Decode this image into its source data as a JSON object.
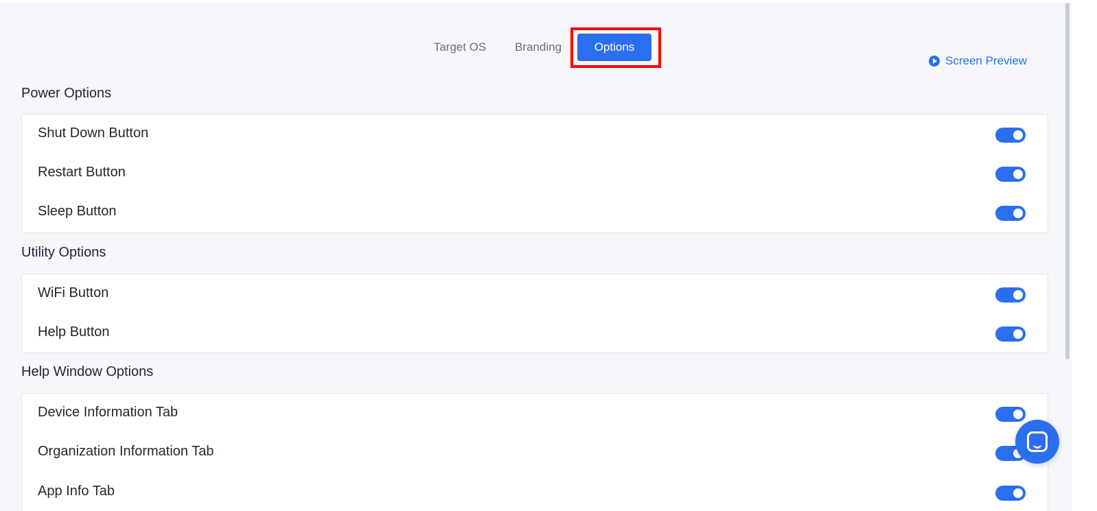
{
  "tabs": {
    "target_os": "Target OS",
    "branding": "Branding",
    "options": "Options"
  },
  "preview": {
    "label": "Screen Preview",
    "icon": "play-circle-icon"
  },
  "sections": [
    {
      "title": "Power Options",
      "items": [
        {
          "label": "Shut Down Button",
          "enabled": true
        },
        {
          "label": "Restart Button",
          "enabled": true
        },
        {
          "label": "Sleep Button",
          "enabled": true
        }
      ]
    },
    {
      "title": "Utility Options",
      "items": [
        {
          "label": "WiFi Button",
          "enabled": true
        },
        {
          "label": "Help Button",
          "enabled": true
        }
      ]
    },
    {
      "title": "Help Window Options",
      "items": [
        {
          "label": "Device Information Tab",
          "enabled": true
        },
        {
          "label": "Organization Information Tab",
          "enabled": true
        },
        {
          "label": "App Info Tab",
          "enabled": true
        }
      ]
    }
  ],
  "chat": {
    "icon": "chat-icon"
  },
  "colors": {
    "accent": "#2b6ef0",
    "highlight": "#ff0000",
    "background": "#f5f7fa"
  }
}
